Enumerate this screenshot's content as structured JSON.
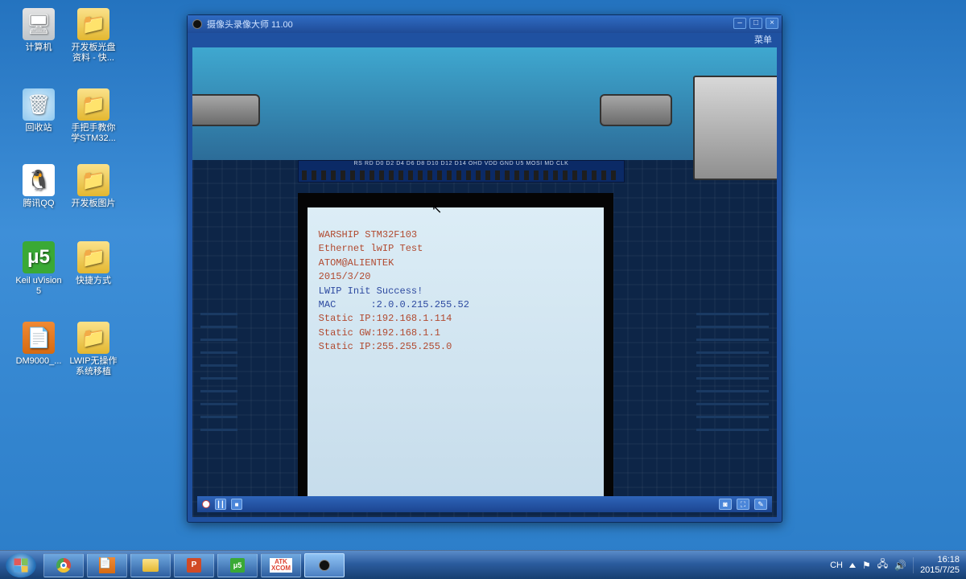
{
  "desktop": {
    "icons": [
      {
        "label": "计算机",
        "icon": "computer"
      },
      {
        "label": "开发板光盘资料 - 快...",
        "icon": "folder"
      },
      {
        "label": "回收站",
        "icon": "recycle"
      },
      {
        "label": "手把手教你学STM32...",
        "icon": "folder"
      },
      {
        "label": "腾讯QQ",
        "icon": "qq"
      },
      {
        "label": "开发板图片",
        "icon": "folder"
      },
      {
        "label": "Keil uVision5",
        "icon": "keil"
      },
      {
        "label": "快捷方式",
        "icon": "folder"
      },
      {
        "label": "DM9000_...",
        "icon": "foxit"
      },
      {
        "label": "LWIP无操作系统移植",
        "icon": "folder"
      }
    ]
  },
  "app": {
    "title": "摄像头录像大师 11.00",
    "menu": "菜单",
    "win_buttons": {
      "min": "–",
      "max": "□",
      "close": "×"
    },
    "pin_labels": "RS  RD  D0  D2  D4  D6  D8  D10  D12  D14  OHD  VDD  GND  U5  MOSI  MD  CLK",
    "lcd_lines": [
      "WARSHIP STM32F103",
      "Ethernet lwIP Test",
      "ATOM@ALIENTEK",
      "2015/3/20",
      "LWIP Init Success!",
      "MAC      :2.0.0.215.255.52",
      "Static IP:192.168.1.114",
      "Static GW:192.168.1.1",
      "Static IP:255.255.255.0"
    ],
    "footer_icons": {
      "snapshot": "◙",
      "fullscreen": "⛶",
      "settings": "✎"
    }
  },
  "taskbar": {
    "items": [
      {
        "type": "chrome"
      },
      {
        "type": "foxit"
      },
      {
        "type": "folder"
      },
      {
        "type": "ppt",
        "text": "P"
      },
      {
        "type": "keil",
        "text": "μ5"
      },
      {
        "type": "atk",
        "text": "ATK\nXCOM"
      },
      {
        "type": "camera"
      }
    ],
    "tray": {
      "ime": "CH",
      "time": "16:18",
      "date": "2015/7/25"
    }
  }
}
